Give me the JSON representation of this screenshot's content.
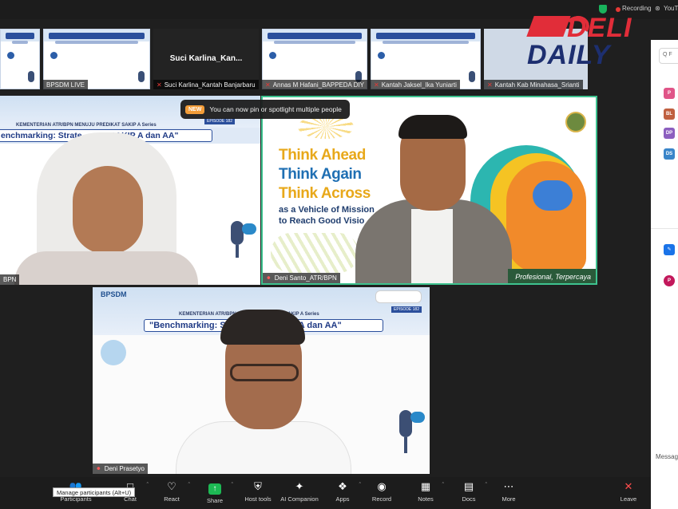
{
  "topbar": {
    "recording_label": "Recording",
    "stream_label": "YouT"
  },
  "thumbnails": [
    {
      "name": "BPSDM LIVE",
      "muted": false,
      "type": "slide"
    },
    {
      "name": "Suci Karlina_Kantah Banjarbaru",
      "center_name": "Suci  Karlina_Kan...",
      "muted": true,
      "type": "dark"
    },
    {
      "name": "Annas M Hafani_BAPPEDA DIY",
      "muted": true,
      "type": "slide"
    },
    {
      "name": "Kantah Jaksel_Ika Yuniarti",
      "muted": true,
      "type": "slide"
    },
    {
      "name": "Kantah Kab Minahasa_Srianti",
      "muted": true,
      "type": "slide"
    }
  ],
  "toast": {
    "badge": "NEW",
    "message": "You can now pin or spotlight multiple people"
  },
  "tiles": {
    "left": {
      "name": "BPN",
      "series": "KEMENTERIAN ATR/BPN MENUJU PREDIKAT SAKIP A Series",
      "title": "enchmarking: Strate",
      "title_tail": "SAKIP A dan AA\"",
      "episode": "EPISODE 182"
    },
    "center": {
      "name": "Deni Santo_ATR/BPN",
      "line1": "Think Ahead",
      "line2": "Think Again",
      "line3": "Think Across",
      "vehicle1": "as a Vehicle of Mission",
      "vehicle2": "to Reach Good Visio",
      "tagline": "Profesional, Terpercaya"
    },
    "bottom": {
      "name": "Deni Prasetyo",
      "logo": "BPSDM",
      "series": "KEMENTERIAN ATR/BPN MENUJU PREDIKAT SAKIP A Series",
      "title": "\"Benchmarking: S",
      "title_tail": "SAKIP A dan AA\"",
      "episode": "EPISODE 182"
    }
  },
  "watermark": {
    "deli": "DELI",
    "daily": "DAILY"
  },
  "right_panel": {
    "search_placeholder": "Q F",
    "avatars": [
      "P",
      "BL",
      "DP",
      "DS",
      "P"
    ],
    "message_label": "Message"
  },
  "toolbar": {
    "tooltip": "Manage participants (Alt+U)",
    "items": [
      {
        "label": "Participants",
        "icon": "people-icon"
      },
      {
        "label": "Chat",
        "icon": "chat-icon"
      },
      {
        "label": "React",
        "icon": "react-icon"
      },
      {
        "label": "Share",
        "icon": "share-icon"
      },
      {
        "label": "Host tools",
        "icon": "shield-icon"
      },
      {
        "label": "AI Companion",
        "icon": "sparkle-icon"
      },
      {
        "label": "Apps",
        "icon": "apps-icon"
      },
      {
        "label": "Record",
        "icon": "record-icon"
      },
      {
        "label": "Notes",
        "icon": "notes-icon"
      },
      {
        "label": "Docs",
        "icon": "docs-icon"
      },
      {
        "label": "More",
        "icon": "more-icon"
      },
      {
        "label": "Leave",
        "icon": "leave-icon"
      }
    ]
  },
  "colors": {
    "accent_green": "#3ec28f",
    "record_red": "#e53935",
    "share_green": "#1db954",
    "deli_red": "#e12d39",
    "daily_blue": "#1d2f70"
  }
}
